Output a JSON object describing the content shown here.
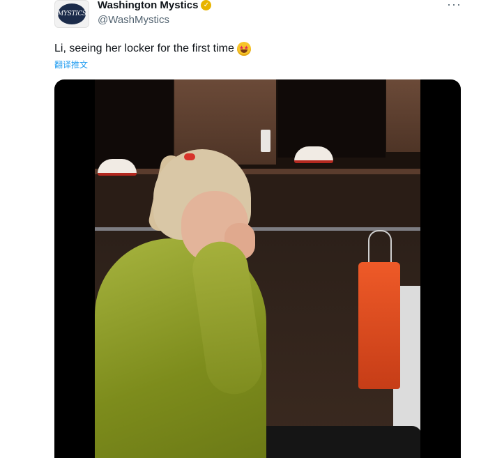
{
  "author": {
    "display_name": "Washington Mystics",
    "handle": "@WashMystics",
    "avatar_text": "MYSTICS",
    "verified_badge": "verified-gold-icon"
  },
  "more_menu": "···",
  "tweet": {
    "text": "Li, seeing her locker for the first time",
    "emoji": "star-struck-emoji",
    "translate_link": "翻译推文"
  },
  "colors": {
    "link": "#1d9bf0",
    "secondary_text": "#536471",
    "verified_gold": "#e8b400"
  }
}
